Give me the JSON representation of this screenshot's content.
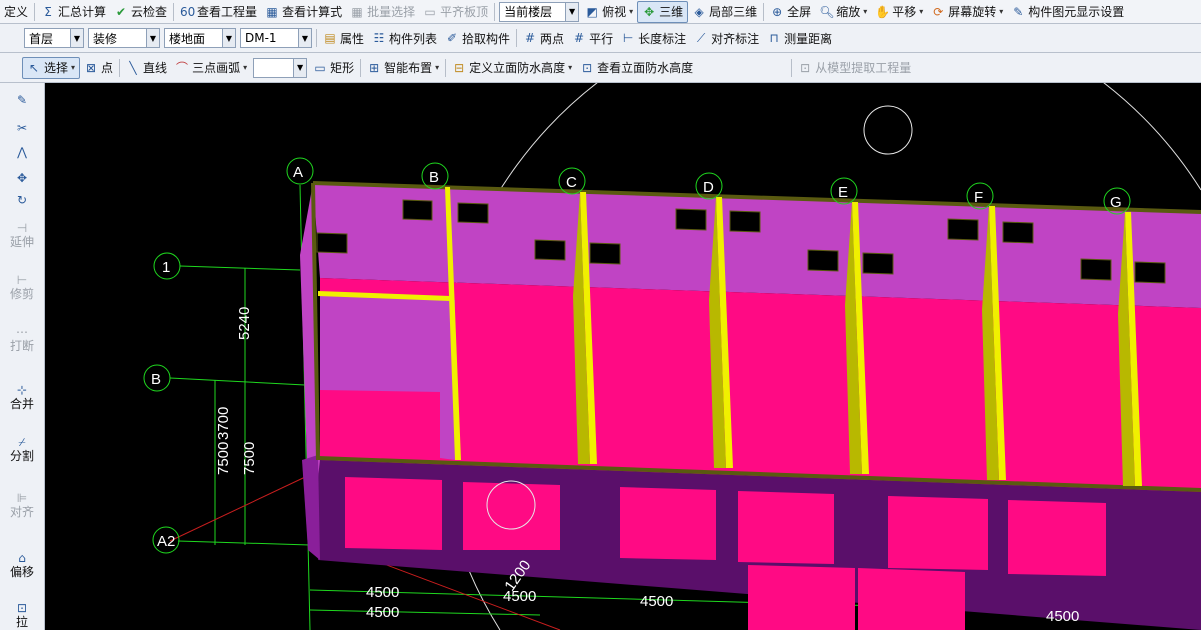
{
  "toolbar1": {
    "define": "定义",
    "sum_calc": "汇总计算",
    "cloud_check": "云检查",
    "view_quantity": "查看工程量",
    "view_formula": "查看计算式",
    "batch_select": "批量选择",
    "align_top": "平齐板顶",
    "floor_combo": "当前楼层",
    "top_view": "俯视",
    "three_d": "三维",
    "local_3d": "局部三维",
    "fullscreen": "全屏",
    "zoom": "缩放",
    "pan": "平移",
    "rotate": "屏幕旋转",
    "display_settings": "构件图元显示设置"
  },
  "toolbar2": {
    "floor": "首层",
    "category": "装修",
    "component_type": "楼地面",
    "component_name": "DM-1",
    "properties": "属性",
    "component_list": "构件列表",
    "pick_component": "拾取构件",
    "two_points": "两点",
    "parallel": "平行",
    "length_dim": "长度标注",
    "align_dim": "对齐标注",
    "measure_distance": "测量距离"
  },
  "toolbar3": {
    "select": "选择",
    "point": "点",
    "line": "直线",
    "arc": "三点画弧",
    "arc_value": "",
    "rect": "矩形",
    "smart_layout": "智能布置",
    "define_facade": "定义立面防水高度",
    "view_facade": "查看立面防水高度",
    "extract_quantity": "从模型提取工程量"
  },
  "leftbar": {
    "extend": "延伸",
    "trim": "修剪",
    "break": "打断",
    "merge": "合并",
    "split": "分割",
    "align": "对齐",
    "offset": "偏移",
    "stretch": "拉"
  },
  "viewport": {
    "col_axes": [
      "A",
      "B",
      "C",
      "D",
      "E",
      "F",
      "G"
    ],
    "row_axes": [
      "1",
      "B",
      "A2"
    ],
    "dims_vertical": [
      "5240",
      "3700",
      "7500",
      "7500"
    ],
    "dims_horizontal": [
      "4500",
      "4500",
      "4500",
      "4500",
      "4500"
    ],
    "dim_diag": "1200",
    "colors": {
      "wall_top": "#c044c4",
      "wall_face": "#ff0a84",
      "column": "#f0f000",
      "slab": "#5a0f6a",
      "edge": "#5a5a10",
      "grid_line": "#1fd81f",
      "red_line": "#c81e1e"
    }
  }
}
